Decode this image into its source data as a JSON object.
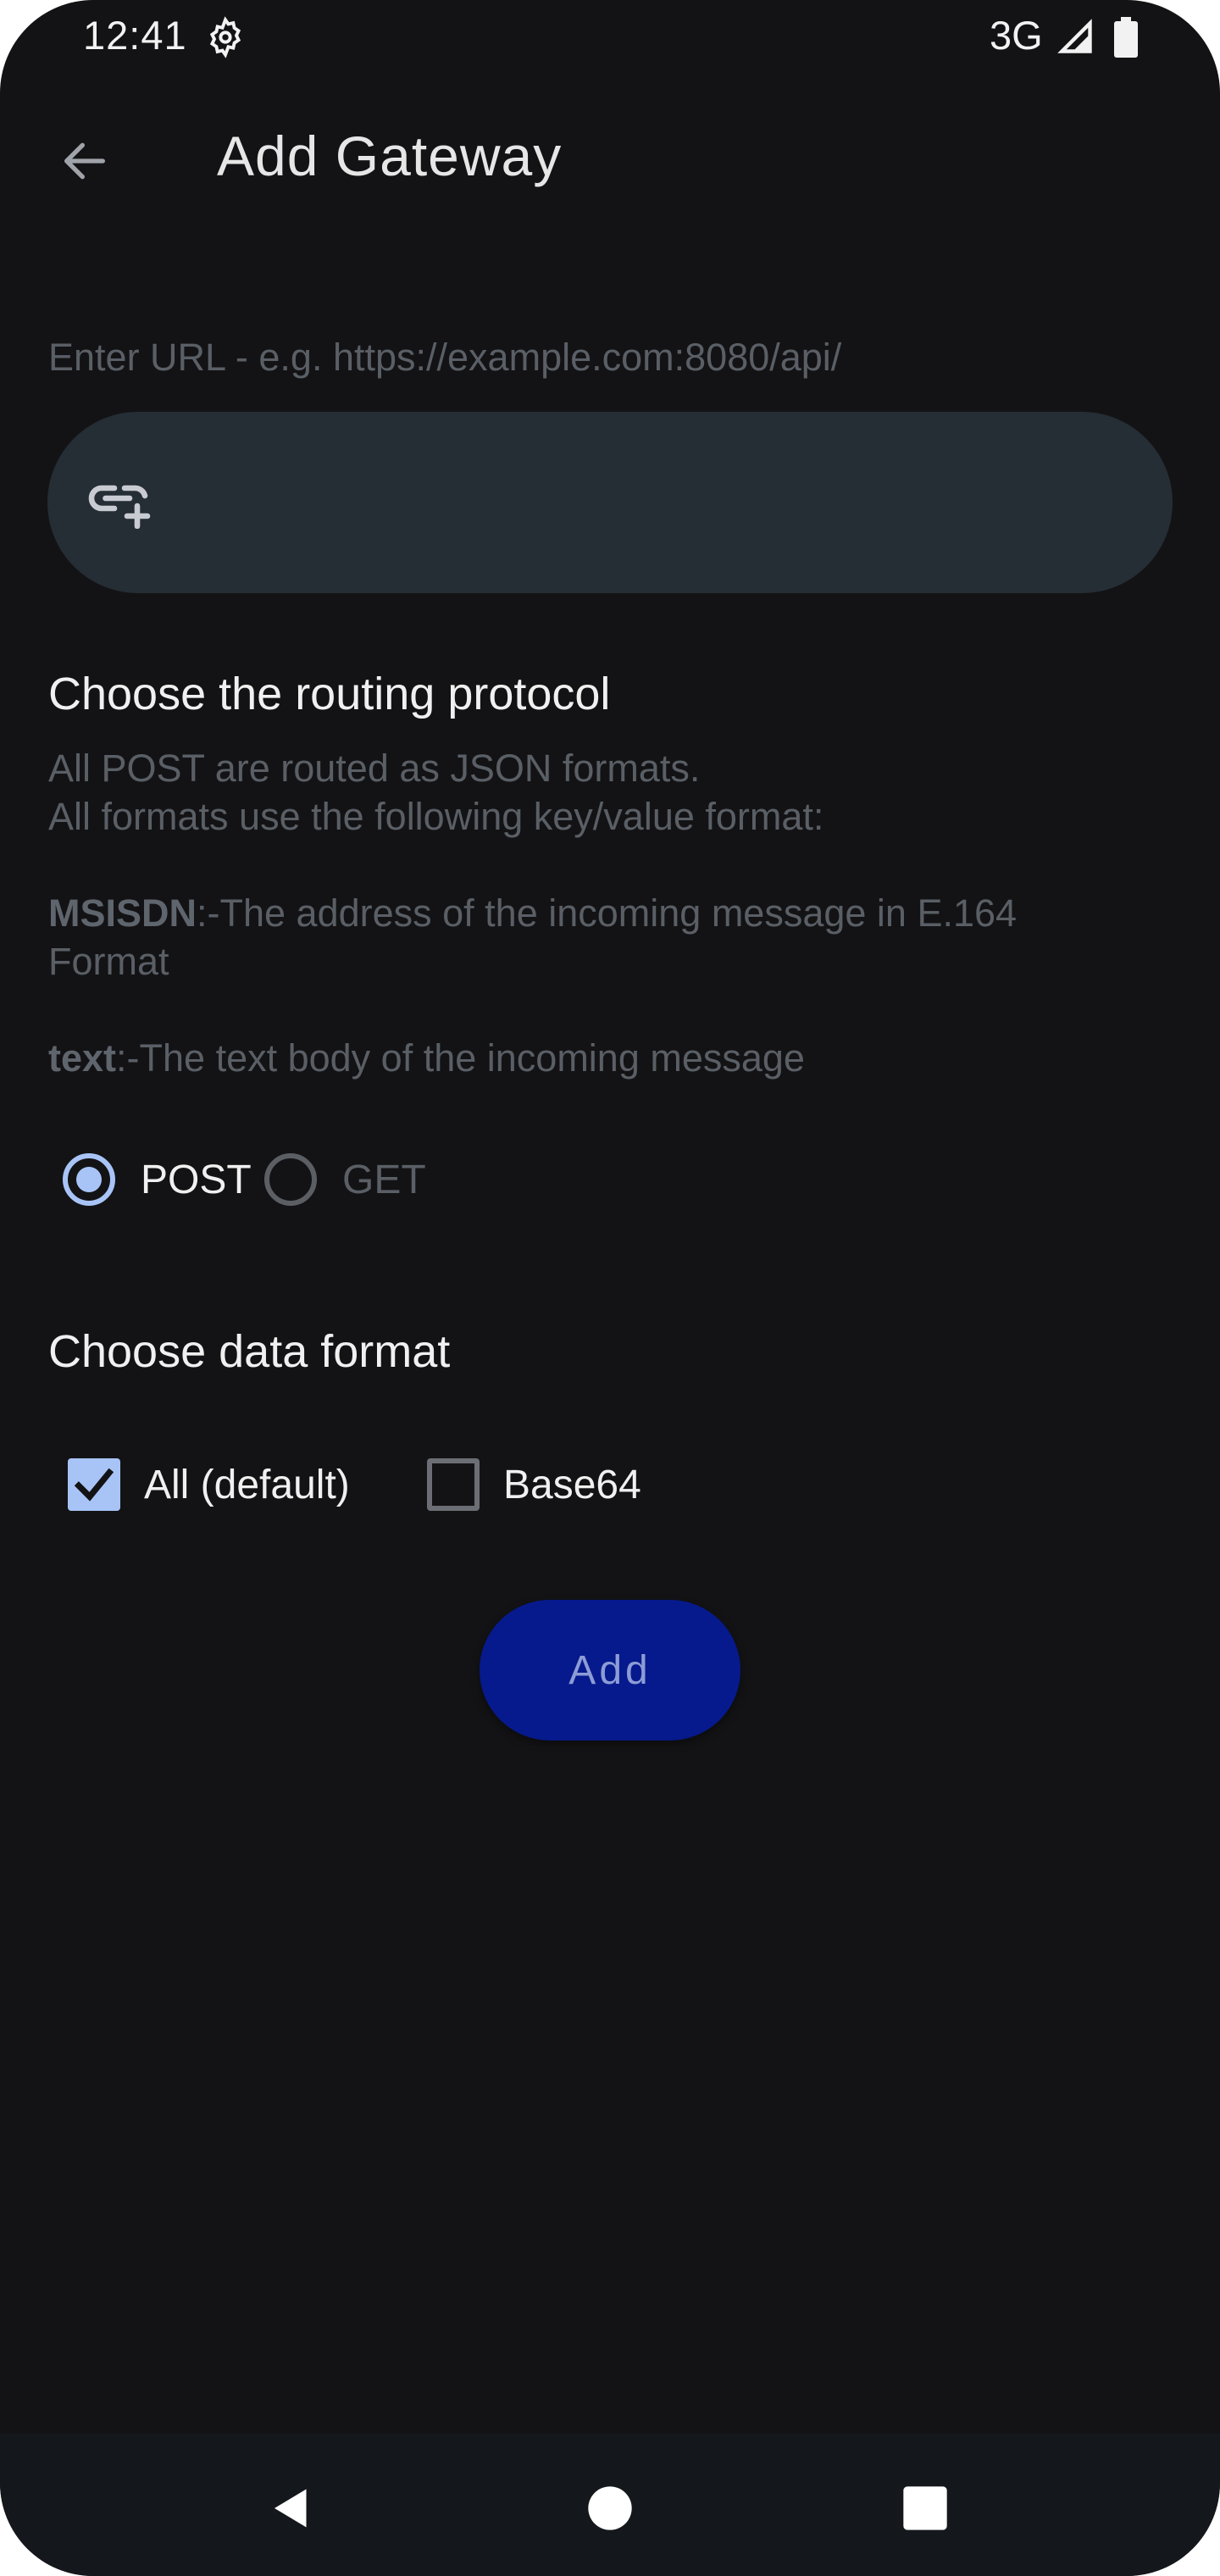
{
  "status_bar": {
    "time": "12:41",
    "network": "3G",
    "settings_icon": "gear-icon",
    "signal_icon": "signal-icon",
    "battery_icon": "battery-icon"
  },
  "header": {
    "back_icon": "arrow-back-icon",
    "title": "Add Gateway"
  },
  "url": {
    "label": "Enter URL - e.g. https://example.com:8080/api/",
    "value": "",
    "icon": "add-link-icon"
  },
  "routing": {
    "title": "Choose the routing protocol",
    "desc_line1": "All POST are routed as JSON formats.",
    "desc_line2": "All formats use the following key/value format:",
    "msisdn_key": "MSISDN",
    "msisdn_desc": ":-The address of the incoming message in E.164",
    "msisdn_desc2": "Format",
    "text_key": "text",
    "text_desc": ":-The text body of the incoming message",
    "options": [
      {
        "label": "POST",
        "selected": true
      },
      {
        "label": "GET",
        "selected": false
      }
    ]
  },
  "data_format": {
    "title": "Choose data format",
    "options": [
      {
        "label": "All (default)",
        "checked": true
      },
      {
        "label": "Base64",
        "checked": false
      }
    ]
  },
  "add_button": {
    "label": "Add"
  },
  "nav": {
    "back_icon": "nav-back-icon",
    "home_icon": "nav-home-icon",
    "recents_icon": "nav-recents-icon"
  },
  "colors": {
    "background": "#131315",
    "field": "#252d35",
    "accent": "#a8c4f7",
    "button": "#061a8d",
    "button_text": "#8e9cd6",
    "muted_text": "#5a5f66"
  }
}
